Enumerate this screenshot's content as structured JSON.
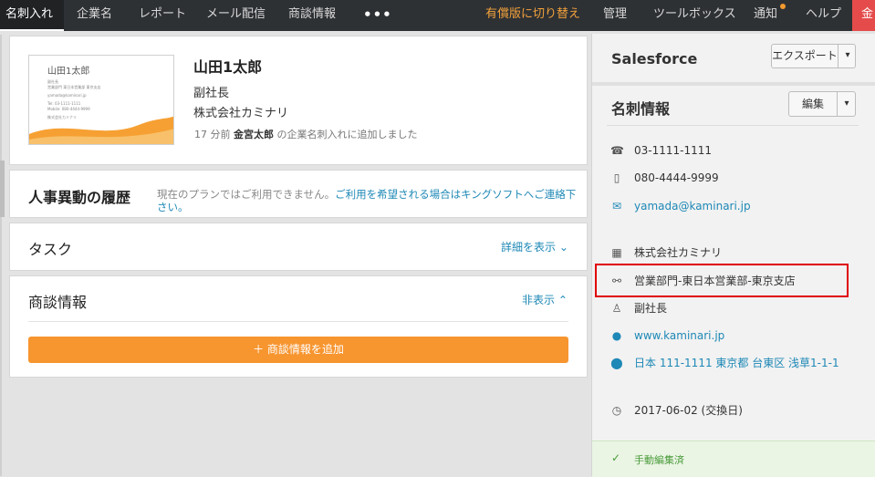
{
  "nav": {
    "items": [
      {
        "label": "名刺入れ"
      },
      {
        "label": "企業名"
      },
      {
        "label": "レポート"
      },
      {
        "label": "メール配信"
      },
      {
        "label": "商談情報"
      },
      {
        "label": "•••"
      },
      {
        "label": "有償版に切り替え"
      },
      {
        "label": "管理"
      },
      {
        "label": "ツールボックス"
      },
      {
        "label": "通知"
      },
      {
        "label": "ヘルプ"
      },
      {
        "label": "金"
      }
    ]
  },
  "contact": {
    "name": "山田1太郎",
    "title": "副社長",
    "company": "株式会社カミナリ",
    "history_prefix": "17 分前",
    "history_user": "金宮太郎",
    "history_suffix": "の企業名刺入れに追加しました",
    "card_image": {
      "name": "山田1太郎",
      "lines": [
        "副社長",
        "営業部門 東日本営業部 東京支店",
        "yamada@kaminari.jp",
        "Tel: 03-1111-1111",
        "Mobile: 080-4444-9999",
        "株式会社カミナリ"
      ]
    }
  },
  "personnel": {
    "title": "人事異動の履歴",
    "notice_gray": "現在のプランではご利用できません。",
    "notice_link_1": "ご利用を希望される場合はキングソフトへご連絡下",
    "notice_link_2": "さい。"
  },
  "tasks": {
    "title": "タスク",
    "toggle": "詳細を表示 ⌄"
  },
  "deals": {
    "title": "商談情報",
    "toggle": "非表示 ⌃",
    "add_button": "＋ 商談情報を追加"
  },
  "salesforce": {
    "title": "Salesforce",
    "export_button": "エクスポート",
    "dropdown": "▾"
  },
  "cardinfo": {
    "title": "名刺情報",
    "edit_button": "編集",
    "dropdown": "▾",
    "phone": "03-1111-1111",
    "mobile": "080-4444-9999",
    "email": "yamada@kaminari.jp",
    "company": "株式会社カミナリ",
    "department": "営業部門-東日本営業部-東京支店",
    "position": "副社長",
    "website": "www.kaminari.jp",
    "address": "日本 111-1111 東京都 台東区 浅草1-1-1",
    "exchange_date": "2017-06-02 (交換日)",
    "status": "手動編集済"
  },
  "icons": {
    "phone": "☎",
    "mobile": "▯",
    "email": "✉",
    "company": "▦",
    "department": "⚯",
    "position": "♙",
    "website": "●",
    "address": "⬤",
    "clock": "◷",
    "check": "✓"
  },
  "colors": {
    "accent_orange": "#f7952f",
    "link_blue": "#1e88b6",
    "nav_bg": "#2e3134",
    "highlight_red": "#e00000"
  }
}
